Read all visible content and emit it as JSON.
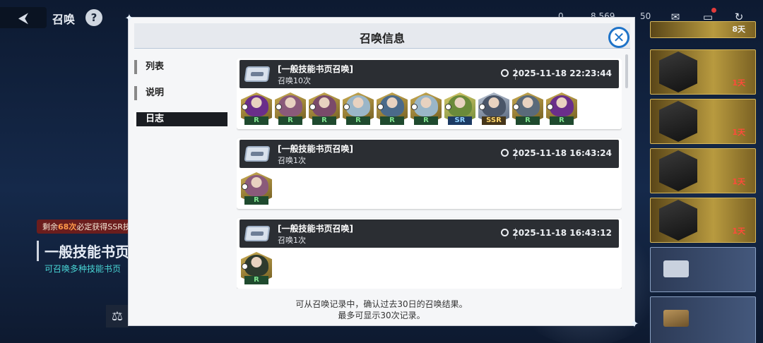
{
  "topbar": {
    "back_icon": "back-arrow-icon",
    "title": "召唤",
    "help_label": "?",
    "resources": [
      "0",
      "8,569",
      "50"
    ],
    "icons": [
      "mail-icon",
      "chat-icon",
      "refresh-icon"
    ]
  },
  "banner": {
    "pity_prefix": "剩余",
    "pity_count": "68次",
    "pity_suffix": "必定获得SSR技",
    "title": "一般技能书页召",
    "subtitle": "可召唤多种技能书页"
  },
  "right_list": {
    "days": [
      "8天",
      "1天",
      "1天",
      "1天",
      "1天"
    ]
  },
  "modal": {
    "title": "召唤信息",
    "close_label": "✕",
    "tabs": [
      {
        "label": "列表"
      },
      {
        "label": "说明"
      },
      {
        "label": "日志"
      }
    ],
    "entries": [
      {
        "name": "[一般技能书页召唤]",
        "count": "召唤10次",
        "time": "2025-11-18 22:23:44",
        "results": [
          {
            "rank": "R",
            "color": "#6a2e8a"
          },
          {
            "rank": "R",
            "color": "#8a5a7a"
          },
          {
            "rank": "R",
            "color": "#7a4a6a"
          },
          {
            "rank": "R",
            "color": "#9ab6c8"
          },
          {
            "rank": "R",
            "color": "#4a6a8a"
          },
          {
            "rank": "R",
            "color": "#9ab6c8"
          },
          {
            "rank": "SR",
            "color": "#6a8a3a"
          },
          {
            "rank": "SSR",
            "color": "#4a5568"
          },
          {
            "rank": "R",
            "color": "#5a6a7a"
          },
          {
            "rank": "R",
            "color": "#6a2e8a"
          }
        ]
      },
      {
        "name": "[一般技能书页召唤]",
        "count": "召唤1次",
        "time": "2025-11-18 16:43:24",
        "results": [
          {
            "rank": "R",
            "color": "#8a5a7a"
          }
        ]
      },
      {
        "name": "[一般技能书页召唤]",
        "count": "召唤1次",
        "time": "2025-11-18 16:43:12",
        "results": [
          {
            "rank": "R",
            "color": "#2e3a2e"
          }
        ]
      }
    ],
    "footer_line1": "可从召唤记录中，确认过去30日的召唤结果。",
    "footer_line2": "最多可显示30次记录。"
  }
}
